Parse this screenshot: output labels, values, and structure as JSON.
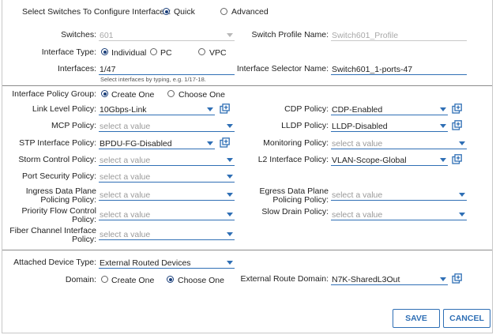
{
  "header": {
    "select_label": "Select Switches To Configure Interfaces:",
    "mode_quick": "Quick",
    "mode_advanced": "Advanced"
  },
  "switches": {
    "label": "Switches:",
    "value": "601"
  },
  "switch_profile": {
    "label": "Switch Profile Name:",
    "value": "Switch601_Profile"
  },
  "interface_type": {
    "label": "Interface Type:",
    "opt_individual": "Individual",
    "opt_pc": "PC",
    "opt_vpc": "VPC"
  },
  "interfaces": {
    "label": "Interfaces:",
    "value": "1/47",
    "hint": "Select interfaces by typing, e.g. 1/17-18."
  },
  "interface_selector": {
    "label": "Interface Selector Name:",
    "value": "Switch601_1-ports-47"
  },
  "policy_group": {
    "label": "Interface Policy Group:",
    "opt_create": "Create One",
    "opt_choose": "Choose One"
  },
  "left_policies": {
    "link_level": {
      "label": "Link Level Policy:",
      "value": "10Gbps-Link"
    },
    "mcp": {
      "label": "MCP Policy:",
      "placeholder": "select a value"
    },
    "stp": {
      "label": "STP Interface Policy:",
      "value": "BPDU-FG-Disabled"
    },
    "storm": {
      "label": "Storm Control Policy:",
      "placeholder": "select a value"
    },
    "port_security": {
      "label": "Port Security Policy:",
      "placeholder": "select a value"
    },
    "ingress_l1": "Ingress Data Plane",
    "ingress_l2": "Policing Policy:",
    "ingress_placeholder": "select a value",
    "pfc_l1": "Priority Flow Control",
    "pfc_l2": "Policy:",
    "pfc_placeholder": "select a value",
    "fc_l1": "Fiber Channel Interface",
    "fc_l2": "Policy:",
    "fc_placeholder": "select a value"
  },
  "right_policies": {
    "cdp": {
      "label": "CDP Policy:",
      "value": "CDP-Enabled"
    },
    "lldp": {
      "label": "LLDP Policy:",
      "value": "LLDP-Disabled"
    },
    "monitoring": {
      "label": "Monitoring Policy:",
      "placeholder": "select a value"
    },
    "l2": {
      "label": "L2 Interface Policy:",
      "value": "VLAN-Scope-Global"
    },
    "egress_l1": "Egress Data Plane",
    "egress_l2": "Policing Policy:",
    "egress_placeholder": "select a value",
    "slow_drain": {
      "label": "Slow Drain Policy:",
      "placeholder": "select a value"
    }
  },
  "attached": {
    "label": "Attached Device Type:",
    "value": "External Routed Devices"
  },
  "domain": {
    "label": "Domain:",
    "opt_create": "Create One",
    "opt_choose": "Choose One"
  },
  "ext_route": {
    "label": "External Route Domain:",
    "value": "N7K-SharedL3Out"
  },
  "actions": {
    "save": "SAVE",
    "cancel": "CANCEL"
  },
  "colors": {
    "accent": "#2f6fb5",
    "radio_selected": "#1a3f7a"
  }
}
